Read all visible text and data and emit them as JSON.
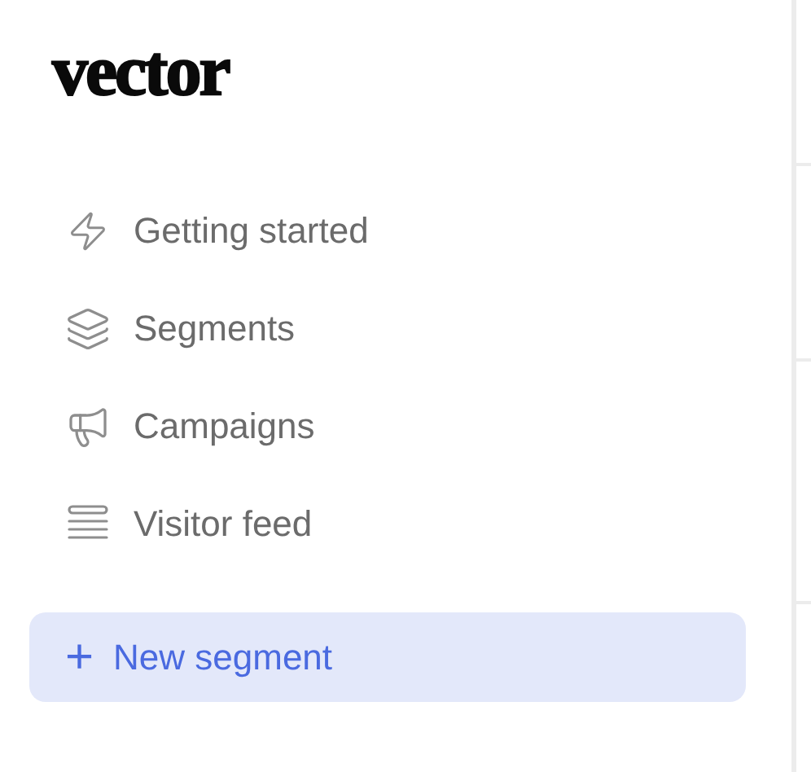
{
  "logo": "vector",
  "nav": [
    {
      "label": "Getting started"
    },
    {
      "label": "Segments"
    },
    {
      "label": "Campaigns"
    },
    {
      "label": "Visitor feed"
    }
  ],
  "new_button": {
    "icon": "+",
    "label": "New segment"
  }
}
